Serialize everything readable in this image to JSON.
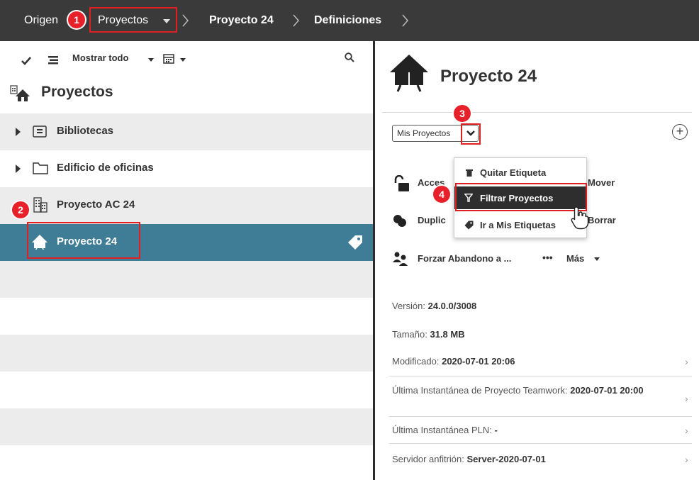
{
  "breadcrumb": {
    "origin": "Origen",
    "projects": "Proyectos",
    "project": "Proyecto 24",
    "definitions": "Definiciones"
  },
  "callouts": [
    "1",
    "2",
    "3",
    "4"
  ],
  "toolbar": {
    "show_all": "Mostrar todo"
  },
  "left": {
    "title": "Proyectos",
    "items": [
      {
        "label": "Bibliotecas"
      },
      {
        "label": "Edificio de oficinas"
      },
      {
        "label": "Proyecto AC 24"
      },
      {
        "label": "Proyecto 24"
      }
    ]
  },
  "right": {
    "title": "Proyecto 24",
    "tag_select": "Mis Proyectos",
    "actions": {
      "access": "Acces",
      "move": "Mover",
      "duplicate": "Duplic",
      "delete": "Borrar",
      "force_leave": "Forzar Abandono a ...",
      "more": "Más"
    },
    "info": [
      {
        "label": "Versión: ",
        "value": "24.0.0/3008"
      },
      {
        "label": "Tamaño: ",
        "value": "31.8 MB"
      },
      {
        "label": "Modificado: ",
        "value": "2020-07-01 20:06"
      },
      {
        "label": "Última Instantánea de Proyecto Teamwork: ",
        "value": "2020-07-01 20:00"
      },
      {
        "label": "Última Instantánea PLN: ",
        "value": "-"
      },
      {
        "label": "Servidor anfitrión: ",
        "value": "Server-2020-07-01"
      }
    ]
  },
  "menu": {
    "items": [
      {
        "label": "Quitar Etiqueta"
      },
      {
        "label": "Filtrar Proyectos"
      },
      {
        "label": "Ir a Mis Etiquetas"
      }
    ]
  },
  "colors": {
    "topbar": "#3a3a3a",
    "selected_row": "#3f7c95",
    "callout_red": "#e8202a"
  }
}
